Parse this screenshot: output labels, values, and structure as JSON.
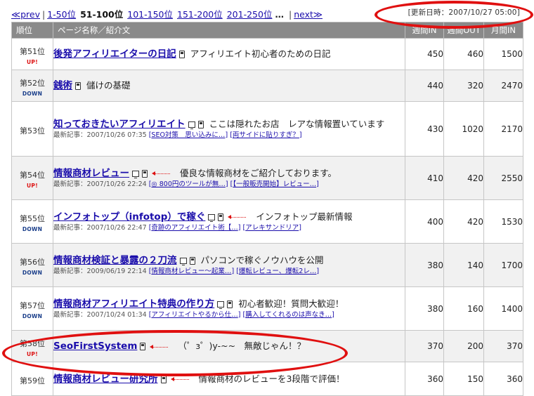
{
  "nav": {
    "prev": "≪prev",
    "pages": [
      {
        "label": "1-50位",
        "current": false
      },
      {
        "label": "51-100位",
        "current": true
      },
      {
        "label": "101-150位",
        "current": false
      },
      {
        "label": "151-200位",
        "current": false
      },
      {
        "label": "201-250位",
        "current": false
      }
    ],
    "ellipsis": "…",
    "next": "next≫"
  },
  "updated": "[更新日時：2007/10/27 05:00]",
  "columns": {
    "rank": "順位",
    "site": "ページ名称／紹介文",
    "weekly_in": "週間IN",
    "weekly_out": "週間OUT",
    "monthly_in": "月間IN"
  },
  "badges": {
    "up": "UP!",
    "down": "DOWN"
  },
  "latest_prefix": "最新記事：",
  "rows": [
    {
      "rank": "第51位",
      "trend": "up",
      "name": "後発アフィリエイターの日記",
      "icons": [
        "mobile"
      ],
      "desc": "アフィリエイト初心者のための日記",
      "latest_date": "",
      "tags": [],
      "win": "450",
      "wout": "460",
      "min": "1500"
    },
    {
      "rank": "第52位",
      "trend": "down",
      "name": "銭術",
      "icons": [
        "mobile"
      ],
      "desc": "儲けの基礎",
      "latest_date": "",
      "tags": [],
      "win": "440",
      "wout": "320",
      "min": "2470"
    },
    {
      "rank": "第53位",
      "trend": "",
      "name": "知っておきたいアフィリエイト",
      "icons": [
        "pc",
        "mobile"
      ],
      "desc": "ここは隠れたお店　レアな情報置いています",
      "latest_date": "2007/10/26 07:35",
      "tags": [
        "SEO対策　思い込みに…",
        "両サイドに貼りすぎ？"
      ],
      "win": "430",
      "wout": "1020",
      "min": "2170"
    },
    {
      "rank": "第54位",
      "trend": "up",
      "name": "情報商材レビュー",
      "icons": [
        "pc",
        "mobile",
        "arrow"
      ],
      "desc": "優良な情報商材をご紹介しております。",
      "latest_date": "2007/10/26 22:24",
      "tags": [
        "◎ 800円のツールが無…",
        "【一般販売開始】レビュー…"
      ],
      "win": "410",
      "wout": "420",
      "min": "2550"
    },
    {
      "rank": "第55位",
      "trend": "down",
      "name": "インフォトップ（infotop）で稼ぐ",
      "icons": [
        "pc",
        "mobile",
        "arrow"
      ],
      "desc": "インフォトップ最新情報",
      "latest_date": "2007/10/26 22:47",
      "tags": [
        "奇跡のアフィリエイト術【…",
        "アレキサンドリア"
      ],
      "win": "400",
      "wout": "420",
      "min": "1530"
    },
    {
      "rank": "第56位",
      "trend": "down",
      "name": "情報商材検証と暴露の２刀流",
      "icons": [
        "pc",
        "mobile"
      ],
      "desc": "パソコンで稼ぐノウハウを公開",
      "latest_date": "2009/06/19 22:14",
      "tags": [
        "情報商材レビュー～起業…",
        "爆転レビュー、爆転2レ…"
      ],
      "win": "380",
      "wout": "140",
      "min": "1700"
    },
    {
      "rank": "第57位",
      "trend": "down",
      "name": "情報商材アフィリエイト特典の作り方",
      "icons": [
        "pc",
        "mobile"
      ],
      "desc": "初心者歓迎！質問大歓迎！",
      "latest_date": "2007/10/24 01:34",
      "tags": [
        "アフィリエイトやるから仕…",
        "購入してくれるのは声なき…"
      ],
      "win": "380",
      "wout": "160",
      "min": "1400"
    },
    {
      "rank": "第58位",
      "trend": "up",
      "name": "SeoFirstSystem",
      "icons": [
        "mobile",
        "arrow"
      ],
      "desc": "（゜з゜)y-~~　無敵じゃん！？",
      "latest_date": "",
      "tags": [],
      "win": "370",
      "wout": "200",
      "min": "370"
    },
    {
      "rank": "第59位",
      "trend": "",
      "name": "情報商材レビュー研究所",
      "icons": [
        "mobile",
        "arrow"
      ],
      "desc": "情報商材のレビューを3段階で評価！",
      "latest_date": "",
      "tags": [],
      "win": "360",
      "wout": "150",
      "min": "360"
    }
  ],
  "colors": {
    "header_bg": "#8a8a8a",
    "link": "#1a0dab",
    "highlight_ring": "#e01010",
    "up": "#dd1111",
    "down": "#1a3e8a"
  }
}
